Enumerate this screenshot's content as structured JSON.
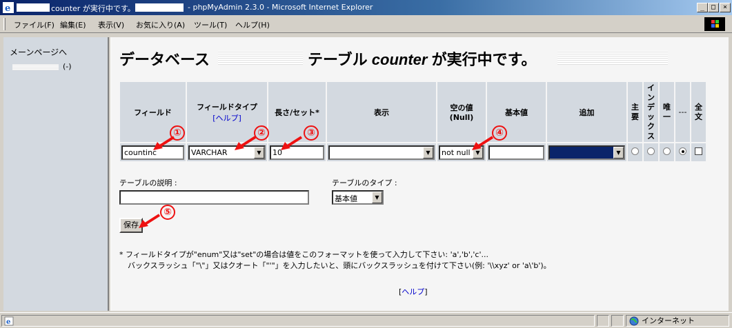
{
  "window": {
    "title_suffix": "counter が実行中です。",
    "title_app": "- phpMyAdmin 2.3.0 - Microsoft Internet Explorer",
    "min_btn": "_",
    "max_btn": "□",
    "close_btn": "×"
  },
  "menu": {
    "items": [
      "ファイル(F)",
      "編集(E)",
      "表示(V)",
      "お気に入り(A)",
      "ツール(T)",
      "ヘルプ(H)"
    ]
  },
  "sidebar": {
    "home_label": "メーンページへ",
    "db_count": "(-)"
  },
  "main": {
    "heading_prefix": "データベース",
    "heading_table": "テーブル ",
    "heading_table_name": "counter",
    "heading_suffix": " が実行中です。"
  },
  "table": {
    "headers": {
      "field": "フィールド",
      "type": "フィールドタイプ",
      "type_help": "[ヘルプ]",
      "length": "長さ/セット*",
      "attributes": "表示",
      "null": "空の値\n(Null)",
      "default": "基本値",
      "extra": "追加",
      "primary": "主\n要",
      "index": "イ\nン\nデ\nッ\nク\nス",
      "unique": "唯\n一",
      "none": "---",
      "fulltext": "全\n文"
    },
    "row": {
      "field_value": "countinc",
      "type_value": "VARCHAR",
      "length_value": "10",
      "attributes_value": "",
      "null_value": "not null",
      "default_value": "",
      "extra_value": "",
      "selected_key": "none"
    }
  },
  "options": {
    "comment_label": "テーブルの説明 :",
    "comment_value": "",
    "type_label": "テーブルのタイプ :",
    "type_value": "基本値"
  },
  "save_label": "保存",
  "note": {
    "line1": "*  フィールドタイプが\"enum\"又は\"set\"の場合は値をこのフォーマットを使って入力して下さい: 'a','b','c'...",
    "line2": "バックスラッシュ「\"\\\"」又はクオート「\"'\"」を入力したいと、頭にバックスラッシュを付けて下さい(例: '\\\\xyz' or 'a\\'b')。"
  },
  "footer": {
    "help_open": "[",
    "help_link": "ヘルプ",
    "help_close": "]"
  },
  "statusbar": {
    "zone": "インターネット"
  },
  "annotations": [
    "①",
    "②",
    "③",
    "④",
    "⑤"
  ],
  "colors": {
    "annotation": "#e11111",
    "title_bar": "#0a246a",
    "table_cell": "#d3d9e0"
  }
}
